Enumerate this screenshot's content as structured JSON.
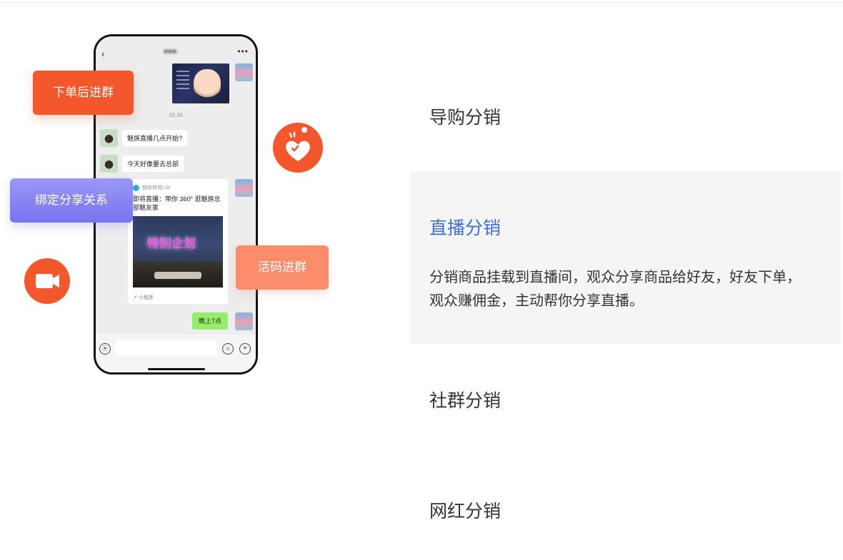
{
  "phone": {
    "back_icon": "chevron-left-icon",
    "more_icon": "more-dots-icon",
    "time": "16:34",
    "messages": [
      "魅族直播几点开始?",
      "今天好像要去总部"
    ],
    "card": {
      "source": "魅族商城Lite",
      "text": "即将直播：带你 360° 逛魅族总部魅友家",
      "sign": "特别企划",
      "mini_label": "小程序"
    },
    "green_message": "晚上7点"
  },
  "tags": {
    "order": "下单后进群",
    "bind": "绑定分享关系",
    "code": "活码进群"
  },
  "colors": {
    "accent_orange": "#f4572b",
    "accent_blue": "#3c6fe0",
    "purple": "#7a73ee",
    "peach": "#fb8d6d"
  },
  "menu": {
    "items": [
      {
        "title": "导购分销"
      },
      {
        "title": "直播分销",
        "desc": "分销商品挂载到直播间，观众分享商品给好友，好友下单，观众赚佣金，主动帮你分享直播。"
      },
      {
        "title": "社群分销"
      },
      {
        "title": "网红分销"
      }
    ]
  }
}
